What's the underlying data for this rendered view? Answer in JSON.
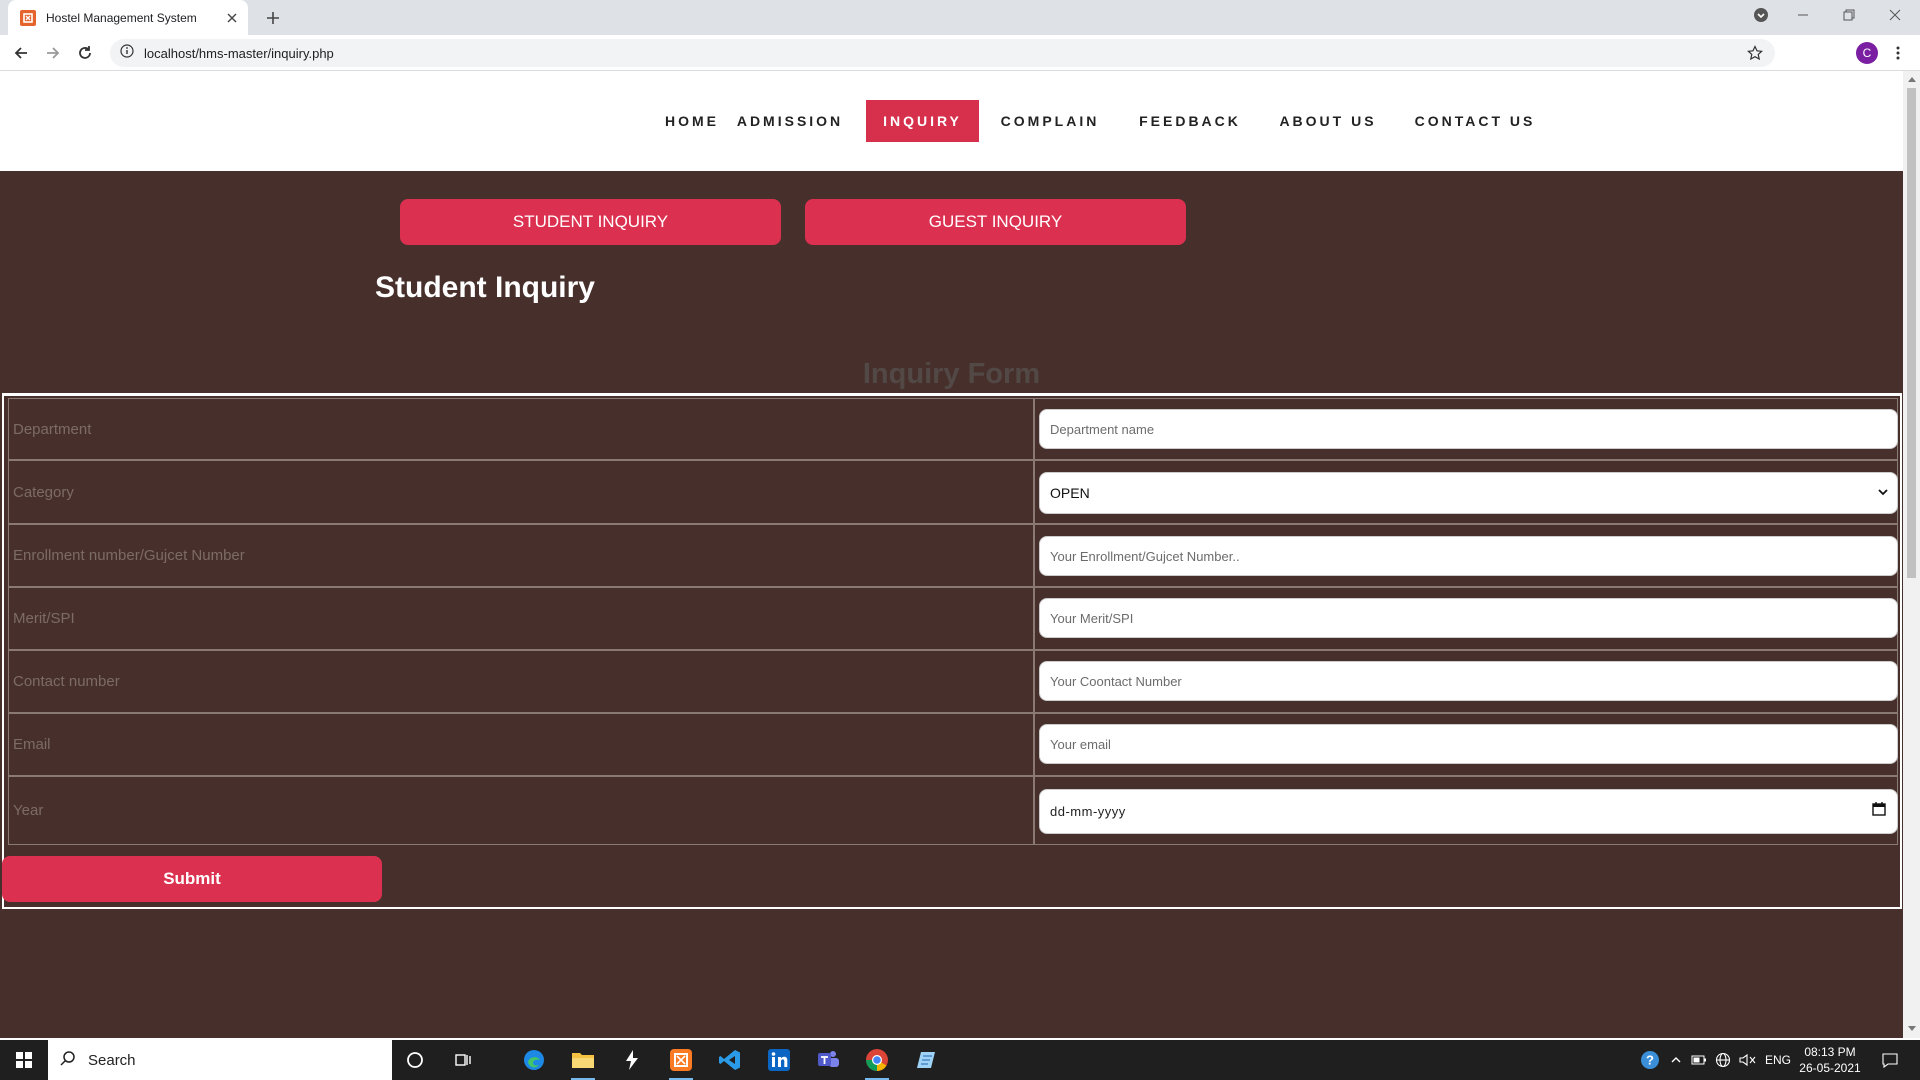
{
  "browser": {
    "tab_title": "Hostel Management System",
    "url_host": "localhost",
    "url_path": "/hms-master/inquiry.php",
    "profile_initial": "C"
  },
  "nav": {
    "items": [
      {
        "label": "HOME",
        "active": false
      },
      {
        "label": "ADMISSION",
        "active": false
      },
      {
        "label": "INQUIRY",
        "active": true
      },
      {
        "label": "COMPLAIN",
        "active": false
      },
      {
        "label": "FEEDBACK",
        "active": false
      },
      {
        "label": "ABOUT US",
        "active": false
      },
      {
        "label": "CONTACT US",
        "active": false
      }
    ]
  },
  "inquiry_tabs": {
    "student": "STUDENT INQUIRY",
    "guest": "GUEST INQUIRY"
  },
  "page": {
    "title": "Student Inquiry",
    "form_title": "Inquiry Form"
  },
  "form": {
    "rows": [
      {
        "label": "Department",
        "placeholder": "Department name",
        "type": "text"
      },
      {
        "label": "Category",
        "value": "OPEN",
        "type": "select"
      },
      {
        "label": "Enrollment number/Gujcet Number",
        "placeholder": "Your Enrollment/Gujcet Number..",
        "type": "text"
      },
      {
        "label": "Merit/SPI",
        "placeholder": "Your Merit/SPI",
        "type": "text"
      },
      {
        "label": "Contact number",
        "placeholder": "Your Coontact Number",
        "type": "text"
      },
      {
        "label": "Email",
        "placeholder": "Your email",
        "type": "text"
      },
      {
        "label": "Year",
        "placeholder": "dd-mm-yyyy",
        "type": "date"
      }
    ],
    "submit": "Submit"
  },
  "taskbar": {
    "search_placeholder": "Search",
    "language": "ENG",
    "time": "08:13 PM",
    "date": "26-05-2021"
  },
  "colors": {
    "page_bg": "#47302c",
    "accent": "#dc3050",
    "nav_active": "#d7304d"
  }
}
